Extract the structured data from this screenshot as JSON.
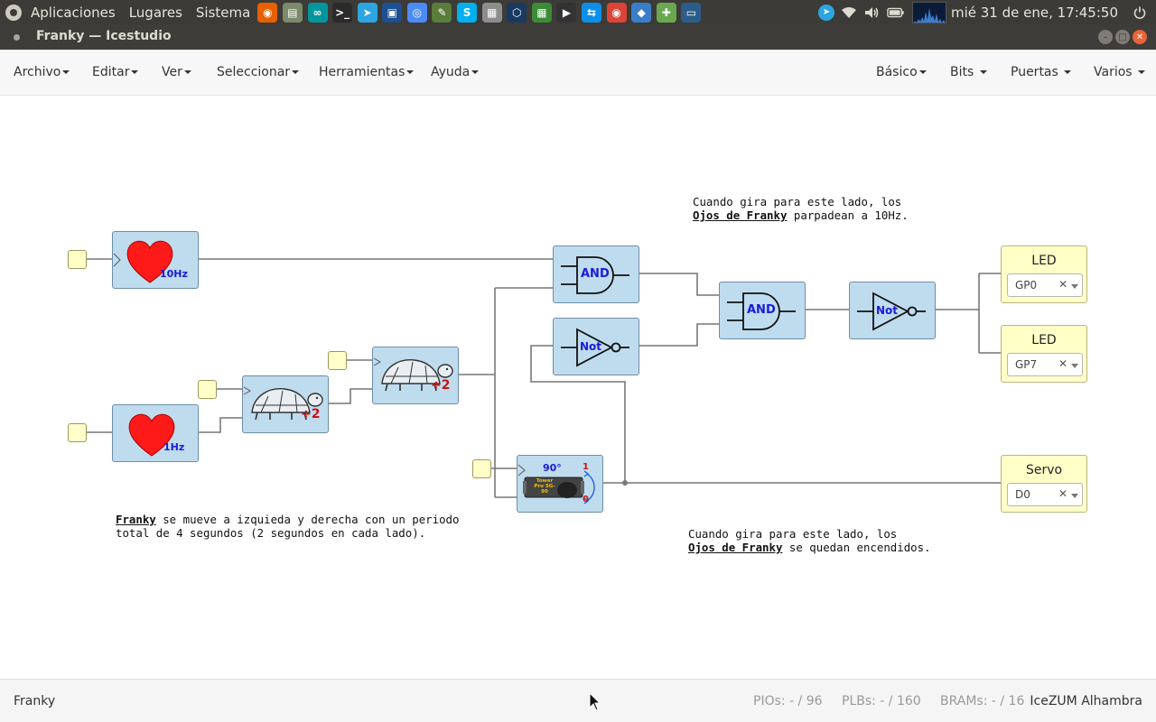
{
  "system_panel": {
    "menus": [
      "Aplicaciones",
      "Lugares",
      "Sistema"
    ],
    "launchers": [
      {
        "icon": "firefox-icon",
        "color": "#e66000",
        "glyph": "◉"
      },
      {
        "icon": "file-manager-icon",
        "color": "#7b8a6a",
        "glyph": "▤"
      },
      {
        "icon": "arduino-icon",
        "color": "#00979c",
        "glyph": "∞"
      },
      {
        "icon": "terminal-icon",
        "color": "#2b2b2b",
        "glyph": ">_"
      },
      {
        "icon": "telegram-icon",
        "color": "#2ca5e0",
        "glyph": "➤"
      },
      {
        "icon": "remote-desktop-icon",
        "color": "#1d4f91",
        "glyph": "▣"
      },
      {
        "icon": "chromium-icon",
        "color": "#4c8bf5",
        "glyph": "◎"
      },
      {
        "icon": "system-tools-icon",
        "color": "#5a7d3a",
        "glyph": "✎"
      },
      {
        "icon": "skype-icon",
        "color": "#00aff0",
        "glyph": "S"
      },
      {
        "icon": "calculator-icon",
        "color": "#8d8d8d",
        "glyph": "▦"
      },
      {
        "icon": "virtualbox-icon",
        "color": "#183a61",
        "glyph": "⬡"
      },
      {
        "icon": "spreadsheet-icon",
        "color": "#3d8b37",
        "glyph": "▦"
      },
      {
        "icon": "media-player-icon",
        "color": "#333333",
        "glyph": "▶"
      },
      {
        "icon": "teamviewer-icon",
        "color": "#0e8ee9",
        "glyph": "⇆"
      },
      {
        "icon": "chrome-icon",
        "color": "#db4437",
        "glyph": "◉"
      },
      {
        "icon": "freecad-icon",
        "color": "#3b7ec8",
        "glyph": "◆"
      },
      {
        "icon": "network-tool-icon",
        "color": "#6aa84f",
        "glyph": "✚"
      },
      {
        "icon": "monitor-icon",
        "color": "#2c5d8a",
        "glyph": "▭"
      }
    ],
    "clock": "mié 31 de ene, 17:45:50"
  },
  "window": {
    "title": "Franky — Icestudio"
  },
  "menubar": {
    "left": [
      "Archivo",
      "Editar",
      "Ver",
      "Seleccionar",
      "Herramientas",
      "Ayuda"
    ],
    "right": [
      "Básico",
      "Bits",
      "Puertas",
      "Varios"
    ]
  },
  "blocks": {
    "heart_10hz_label": "10Hz",
    "heart_1hz_label": "1Hz",
    "div_a_label": "÷2",
    "div_b_label": "÷2",
    "and_top_label": "AND",
    "and_main_label": "AND",
    "not_mid_label": "Not",
    "not_out_label": "Not",
    "servo_angle_label": "90°",
    "servo_brand_label": "Tower Pro SG-90",
    "servo_one_label": "1",
    "servo_zero_label": "0"
  },
  "outputs": [
    {
      "label": "LED",
      "value": "GP0"
    },
    {
      "label": "LED",
      "value": "GP7"
    },
    {
      "label": "Servo",
      "value": "D0"
    }
  ],
  "notes": {
    "top_line1": "Cuando gira para este lado, los",
    "top_bold": "Ojos de Franky",
    "top_rest": " parpadean a 10Hz.",
    "bottom_line1": "Cuando gira para este lado, los",
    "bottom_bold": "Ojos de Franky",
    "bottom_rest": " se quedan encendidos.",
    "left_bold": "Franky",
    "left_rest1": " se mueve a izquieda y derecha con un periodo",
    "left_line2": "total de 4 segundos (2 segundos en cada lado)."
  },
  "statusbar": {
    "project": "Franky",
    "pios": "PIOs:  - / 96",
    "plbs": "PLBs:  - / 160",
    "brams": "BRAMs:  - / 16",
    "board": "IceZUM Alhambra"
  }
}
